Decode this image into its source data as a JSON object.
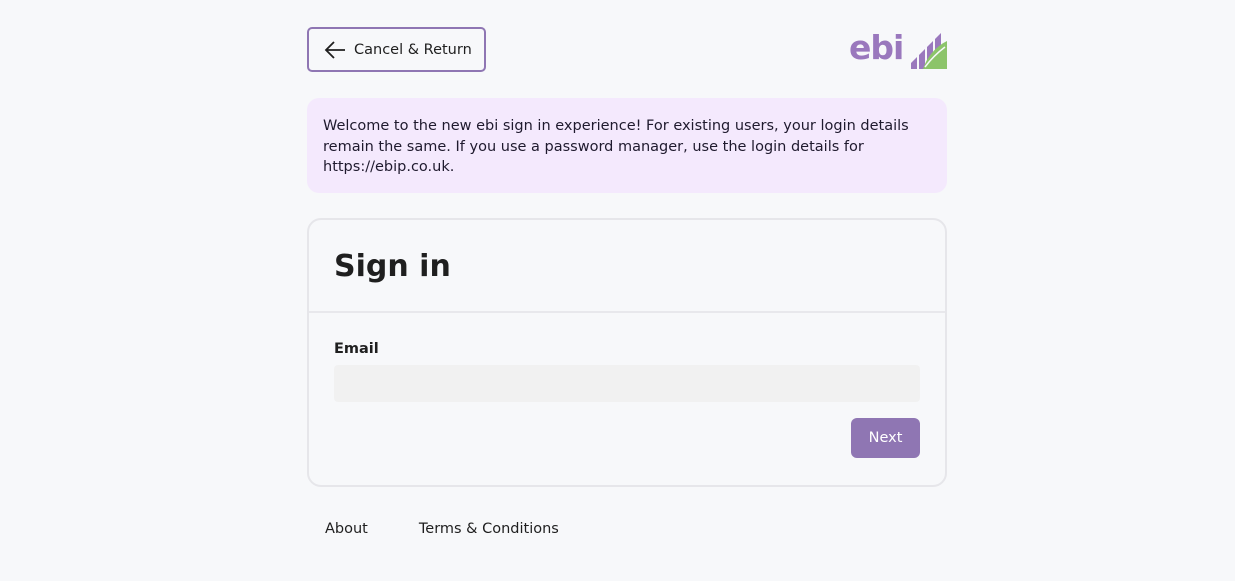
{
  "header": {
    "cancel_label": "Cancel & Return",
    "logo_text": "ebi",
    "back_icon": "arrow-left-icon",
    "brand_colors": {
      "purple": "#9a78bd",
      "green": "#8cc46a",
      "button": "#8f76b3"
    }
  },
  "notice": {
    "text": "Welcome to the new ebi sign in experience! For existing users, your login details remain the same. If you use a password manager, use the login details for https://ebip.co.uk."
  },
  "signin": {
    "title": "Sign in",
    "email_label": "Email",
    "email_value": "",
    "email_placeholder": "",
    "next_label": "Next"
  },
  "footer": {
    "links": [
      "About",
      "Terms & Conditions"
    ]
  }
}
